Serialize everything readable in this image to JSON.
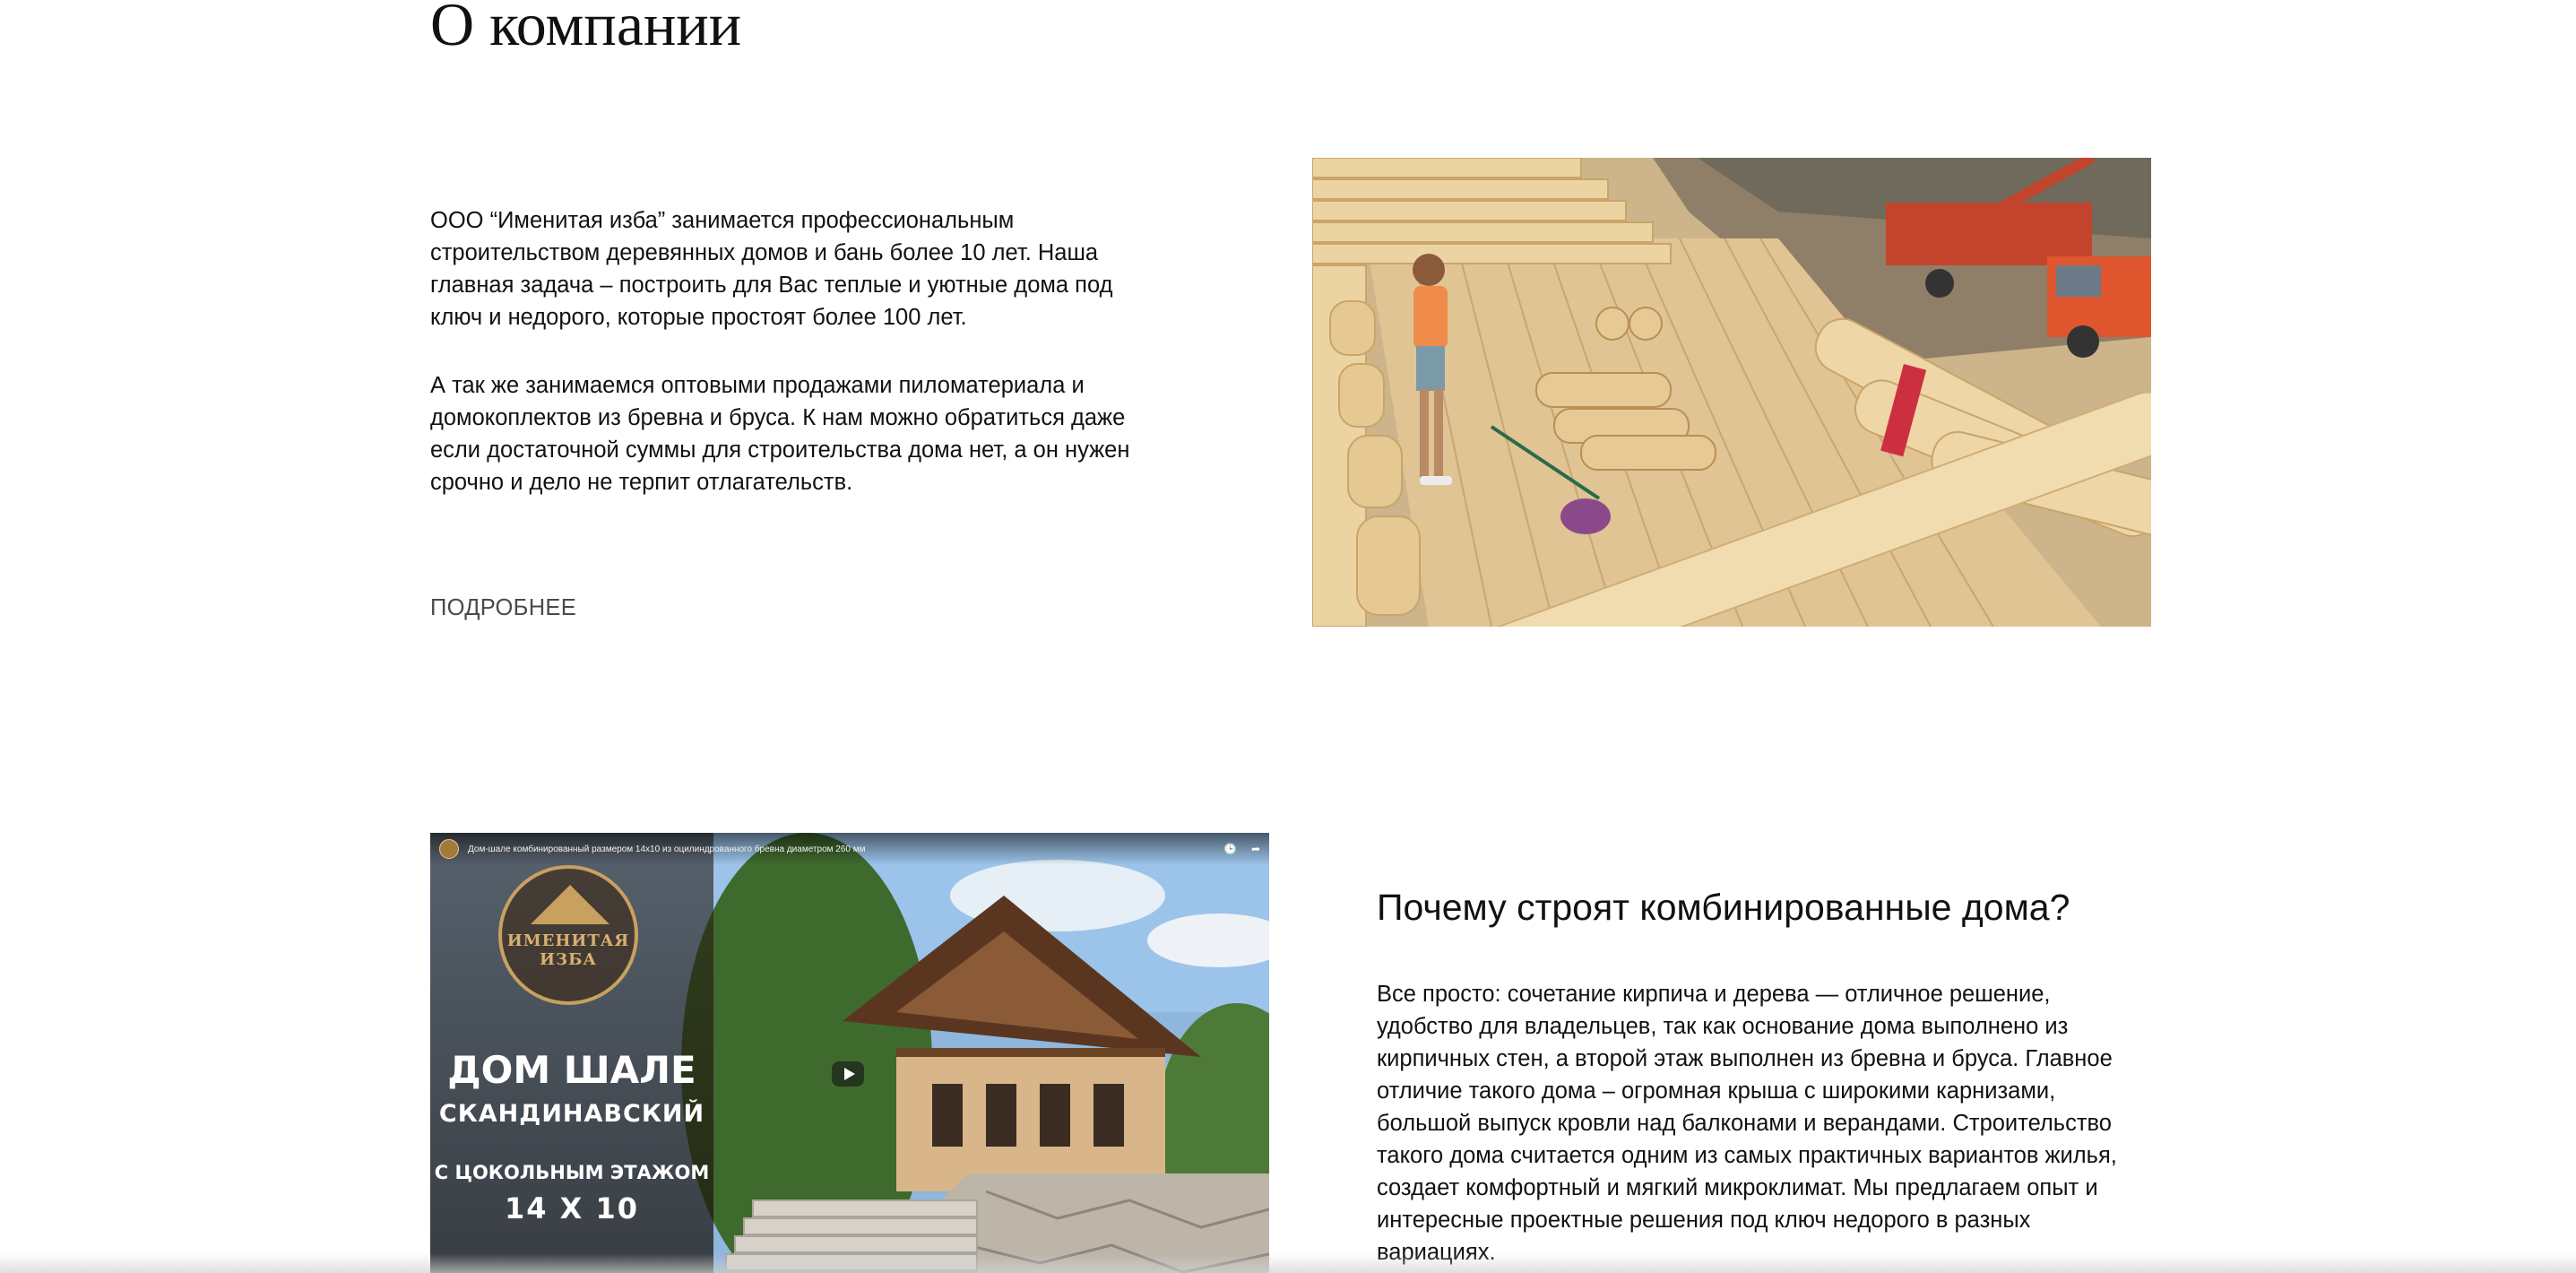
{
  "about": {
    "title": "О компании",
    "paragraph_1": "ООО “Именитая изба” занимается профессиональным строительством деревянных домов и бань более 10 лет. Наша главная задача – построить для Вас теплые и уютные дома под ключ и недорого, которые простоят более 100 лет.",
    "paragraph_2": "А так же занимаемся оптовыми продажами пиломатериала и домокоплектов из бревна и бруса. К нам можно обратиться даже если достаточной суммы для строительства дома нет, а он нужен срочно и дело не терпит отлагательств.",
    "more_label": "ПОДРОБНЕЕ"
  },
  "video": {
    "title": "Дом-шале комбинированный размером 14х10 из оцилиндрованного бревна диаметром 260 мм",
    "logo_text": "ИМЕНИТАЯ ИЗБА",
    "line_1": "ДОМ ШАЛЕ",
    "line_2": "СКАНДИНАВСКИЙ",
    "line_3": "С ЦОКОЛЬНЫМ ЭТАЖОМ",
    "line_4": "14 X 10",
    "action_watch_later": "Смотреть позже",
    "action_share": "Поделиться"
  },
  "combined": {
    "heading": "Почему строят комбинированные дома?",
    "text": "Все просто: сочетание кирпича и дерева — отличное решение, удобство для владельцев, так как основание дома выполнено из кирпичных стен, а второй этаж выполнен из бревна и бруса. Главное отличие такого дома – огромная крыша с широкими карнизами, большой выпуск кровли над балконами и верандами. Строительство такого дома считается одним из самых практичных вариантов жилья, создает комфортный и мягкий микроклимат. Мы предлагаем опыт и интересные проектные решения под ключ недорого в разных вариациях."
  },
  "colors": {
    "text": "#111111",
    "link": "#4a4a4a",
    "background": "#ffffff",
    "wood": "#e3c48f"
  }
}
